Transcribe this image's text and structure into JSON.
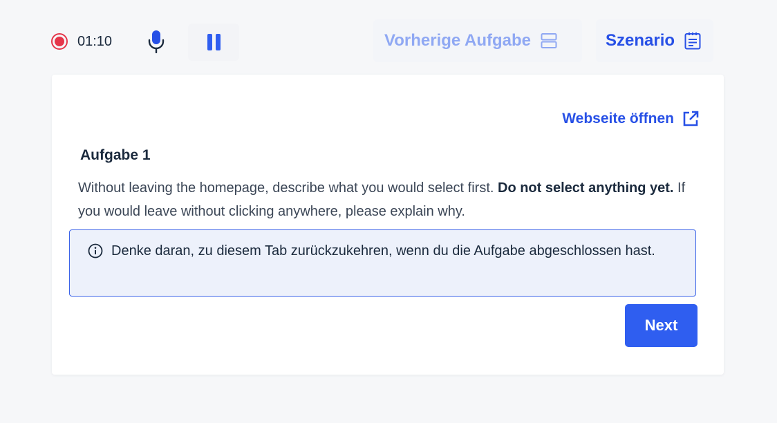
{
  "recorder": {
    "elapsed": "01:10",
    "recording_color": "#e5364a"
  },
  "toolbar": {
    "previous_task_label": "Vorherige Aufgabe",
    "scenario_label": "Szenario"
  },
  "card": {
    "open_website_label": "Webseite öffnen",
    "task_title": "Aufgabe 1",
    "task_description": {
      "part1": "Without leaving the homepage, describe what you would select first. ",
      "bold": "Do not select anything yet.",
      "part2": " If you would leave without clicking anywhere, please explain why."
    },
    "info_message": "Denke daran, zu diesem Tab zurückzukehren, wenn du die Aufgabe abgeschlossen hast.",
    "next_label": "Next"
  },
  "colors": {
    "accent": "#2f5ef0",
    "link": "#2750e6",
    "muted_link": "#8fa8f3",
    "info_border": "#3b63e8",
    "info_background": "#edf1fb"
  },
  "icons": {
    "record": "record-icon",
    "mic": "microphone-icon",
    "pause": "pause-icon",
    "previous_task": "split-layout-icon",
    "scenario": "clipboard-list-icon",
    "open_website": "external-link-icon",
    "info": "info-icon"
  }
}
